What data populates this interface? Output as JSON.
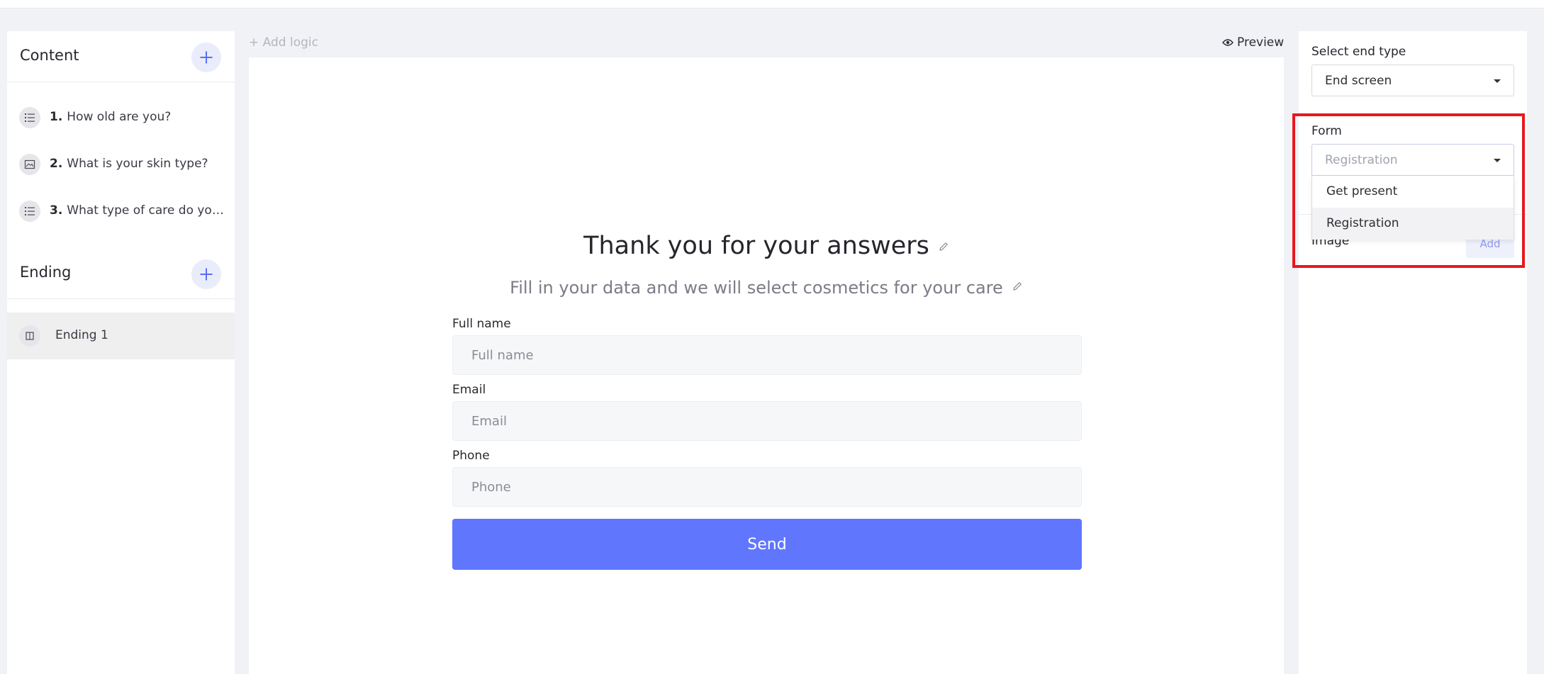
{
  "sidebar": {
    "content_title": "Content",
    "questions": [
      {
        "num": "1.",
        "text": "How old are you?",
        "icon": "list-icon"
      },
      {
        "num": "2.",
        "text": "What is your skin type?",
        "icon": "image-choice-icon"
      },
      {
        "num": "3.",
        "text": "What type of care do you prefer?",
        "icon": "list-icon"
      }
    ],
    "ending_title": "Ending",
    "endings": [
      {
        "text": "Ending 1",
        "icon": "ending-screen-icon"
      }
    ]
  },
  "canvas": {
    "add_logic": "+ Add logic",
    "preview": "Preview",
    "title": "Thank you for your answers",
    "subtitle": "Fill in your data and we will select cosmetics for your care",
    "fields": [
      {
        "label": "Full name",
        "placeholder": "Full name"
      },
      {
        "label": "Email",
        "placeholder": "Email"
      },
      {
        "label": "Phone",
        "placeholder": "Phone"
      }
    ],
    "send_label": "Send"
  },
  "right_panel": {
    "end_type_label": "Select end type",
    "end_type_value": "End screen",
    "form_label": "Form",
    "form_value": "Registration",
    "form_options": [
      "Get present",
      "Registration"
    ],
    "image_label": "Image",
    "image_add": "Add"
  },
  "colors": {
    "accent": "#5f76fd",
    "highlight": "#e8191f",
    "background": "#f1f2f6"
  }
}
